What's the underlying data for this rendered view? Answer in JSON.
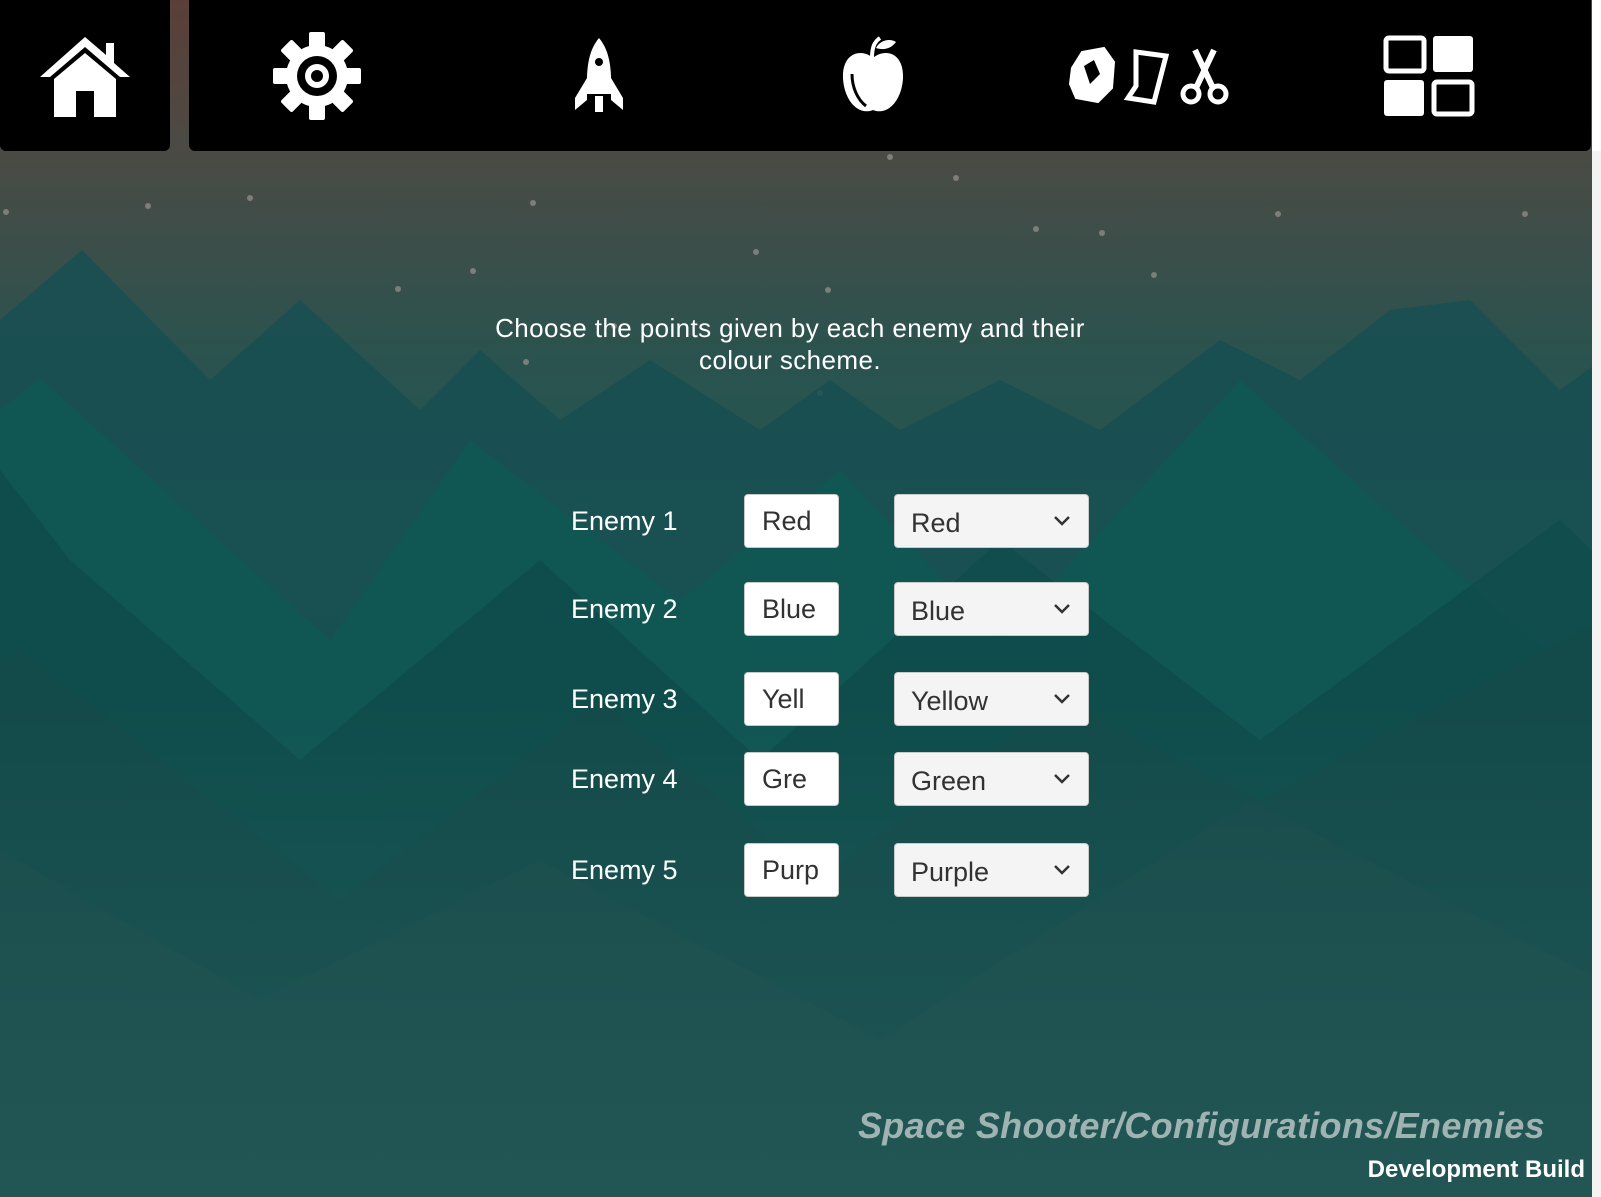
{
  "instructions": "Choose the points given by each enemy and their colour scheme.",
  "enemies": [
    {
      "label": "Enemy 1",
      "points": "Red",
      "colour": "Red"
    },
    {
      "label": "Enemy 2",
      "points": "Blue",
      "colour": "Blue"
    },
    {
      "label": "Enemy 3",
      "points": "Yell",
      "colour": "Yellow"
    },
    {
      "label": "Enemy 4",
      "points": "Gre",
      "colour": "Green"
    },
    {
      "label": "Enemy 5",
      "points": "Purp",
      "colour": "Purple"
    }
  ],
  "toolbar_icons": [
    "home-icon",
    "gear-icon",
    "rocket-icon",
    "apple-icon",
    "rock-paper-scissors-icon",
    "grid-icon"
  ],
  "breadcrumb": "Space Shooter/Configurations/Enemies",
  "dev_build": "Development Build",
  "colors": {
    "sky_top": "#4e4540",
    "sky_bottom": "#1c5553",
    "toolbar": "#000000",
    "breadcrumb": "#9fb3b2"
  }
}
